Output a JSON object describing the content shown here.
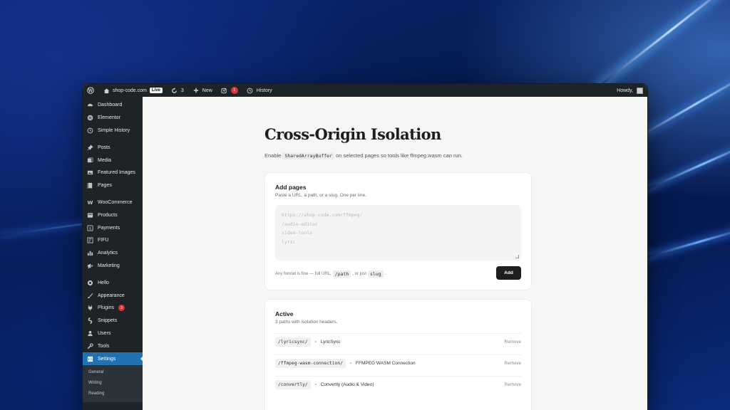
{
  "adminbar": {
    "site_name": "shop-code.com",
    "live_badge": "Live",
    "updates_count": "3",
    "new_label": "New",
    "yoast_badge": "1",
    "history_label": "History",
    "howdy": "Howdy,"
  },
  "sidebar": {
    "items": [
      {
        "label": "Dashboard",
        "icon": "dashboard-icon"
      },
      {
        "label": "Elementor",
        "icon": "elementor-icon"
      },
      {
        "label": "Simple History",
        "icon": "history-icon"
      },
      {
        "label": "Posts",
        "icon": "pin-icon"
      },
      {
        "label": "Media",
        "icon": "media-icon"
      },
      {
        "label": "Featured Images",
        "icon": "image-icon"
      },
      {
        "label": "Pages",
        "icon": "pages-icon"
      },
      {
        "label": "WooCommerce",
        "icon": "woocommerce-icon"
      },
      {
        "label": "Products",
        "icon": "products-icon"
      },
      {
        "label": "Payments",
        "icon": "payments-icon"
      },
      {
        "label": "FIFU",
        "icon": "fifu-icon"
      },
      {
        "label": "Analytics",
        "icon": "analytics-icon"
      },
      {
        "label": "Marketing",
        "icon": "megaphone-icon"
      },
      {
        "label": "Hello",
        "icon": "hello-icon"
      },
      {
        "label": "Appearance",
        "icon": "brush-icon"
      },
      {
        "label": "Plugins",
        "icon": "plugin-icon",
        "badge": "3"
      },
      {
        "label": "Snippets",
        "icon": "snippets-icon"
      },
      {
        "label": "Users",
        "icon": "users-icon"
      },
      {
        "label": "Tools",
        "icon": "wrench-icon"
      },
      {
        "label": "Settings",
        "icon": "settings-icon"
      }
    ],
    "submenu": [
      "General",
      "Writing",
      "Reading"
    ]
  },
  "main": {
    "title": "Cross-Origin Isolation",
    "desc_pre": "Enable",
    "desc_code": "SharedArrayBuffer",
    "desc_post": "on selected pages so tools like ffmpeg.wasm can run."
  },
  "add_card": {
    "title": "Add pages",
    "subtitle": "Paste a URL, a path, or a slug. One per line.",
    "placeholder_lines": [
      "https://shop-code.com/ffmpeg/",
      "/audio-editor",
      "video-tools",
      "lyric"
    ],
    "hint_pre": "Any format is fine — full URL,",
    "hint_code1": "/path",
    "hint_mid": ", or just",
    "hint_code2": "slug",
    "hint_post": ".",
    "add_label": "Add"
  },
  "active_card": {
    "title": "Active",
    "subtitle": "3 paths with isolation headers.",
    "rows": [
      {
        "slug": "/lyricsync/",
        "name": "LyricSync",
        "remove": "Remove"
      },
      {
        "slug": "/ffmpeg-wasm-connection/",
        "name": "FFMPEG WASM Connection",
        "remove": "Remove"
      },
      {
        "slug": "/convertly/",
        "name": "Convertly (Audio & Video)",
        "remove": "Remove"
      }
    ]
  },
  "colors": {
    "admin_dark": "#1d2327",
    "active_menu": "#2271b1",
    "badge_red": "#d63638",
    "button_dark": "#1e1e1e"
  }
}
